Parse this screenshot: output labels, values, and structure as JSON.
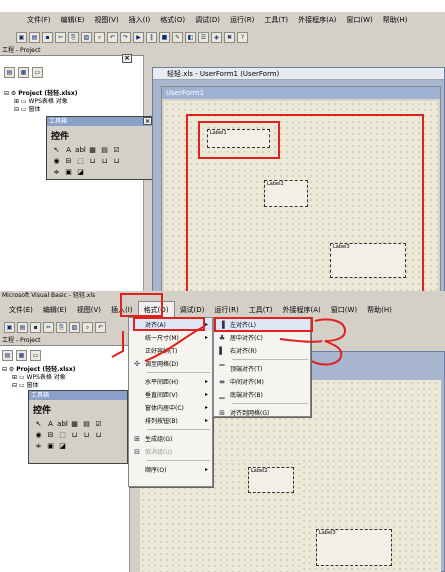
{
  "menu_labels": [
    "文件(F)",
    "编辑(E)",
    "视图(V)",
    "插入(I)",
    "格式(O)",
    "调试(D)",
    "运行(R)",
    "工具(T)",
    "外接程序(A)",
    "窗口(W)",
    "帮助(H)"
  ],
  "menu_labels_lower": [
    "文件(E)",
    "编辑(E)",
    "视图(V)",
    "插入(I)",
    "格式(O)",
    "调试(D)",
    "运行(R)",
    "工具(T)",
    "外接程序(A)",
    "窗口(W)",
    "帮助(H)"
  ],
  "project_panel_title": "工程 - Project",
  "tree": {
    "project": "Project (轻轻.xlsx)",
    "wps_objects": "WPS表格 对象",
    "forms": "窗体"
  },
  "toolbox": {
    "title": "工具箱",
    "controls_tab": "控件",
    "row1": [
      "↖",
      "A",
      "abl",
      "▦",
      "▤",
      "☑"
    ],
    "row2": [
      "◉",
      "⊟",
      "⬚",
      "⊔",
      "⊔",
      "⊔"
    ],
    "row3": [
      "≑",
      "▣",
      "◪"
    ]
  },
  "mdi_title": "轻轻.xls - UserForm1 (UserForm)",
  "form_title": "UserForm1",
  "labels": [
    "Label1",
    "Label2",
    "Label3"
  ],
  "app_title_fragment": "Microsoft Visual Basic - 轻轻.xls",
  "format_menu": [
    {
      "label": "对齐(A)",
      "arrow": true,
      "icon": ""
    },
    {
      "label": "统一尺寸(M)",
      "arrow": true,
      "icon": ""
    },
    {
      "label": "正好容纳(T)",
      "arrow": false,
      "icon": ""
    },
    {
      "label": "调至网格(D)",
      "arrow": false,
      "icon": "✣"
    },
    {
      "label": "水平间距(H)",
      "arrow": true,
      "icon": ""
    },
    {
      "label": "垂直间距(V)",
      "arrow": true,
      "icon": ""
    },
    {
      "label": "窗体内居中(C)",
      "arrow": true,
      "icon": ""
    },
    {
      "label": "排列按钮(B)",
      "arrow": true,
      "icon": ""
    },
    {
      "label": "生成组(G)",
      "arrow": false,
      "icon": "⊞"
    },
    {
      "label": "取消组(U)",
      "arrow": false,
      "icon": "⊟",
      "disabled": true
    },
    {
      "label": "顺序(O)",
      "arrow": true,
      "icon": ""
    }
  ],
  "align_submenu": [
    {
      "label": "左对齐(L)",
      "icon": "▐"
    },
    {
      "label": "居中对齐(C)",
      "icon": "♣"
    },
    {
      "label": "右对齐(R)",
      "icon": "▌"
    },
    {
      "label": "顶端对齐(T)",
      "icon": "▔"
    },
    {
      "label": "中间对齐(M)",
      "icon": "⇼"
    },
    {
      "label": "底端对齐(B)",
      "icon": "▁"
    },
    {
      "label": "对齐到网格(G)",
      "icon": "⊞"
    }
  ],
  "annotations": [
    "1",
    "2",
    "3"
  ],
  "colors": {
    "accent_red": "#e0221c",
    "menu_face": "#d4d0c8"
  }
}
